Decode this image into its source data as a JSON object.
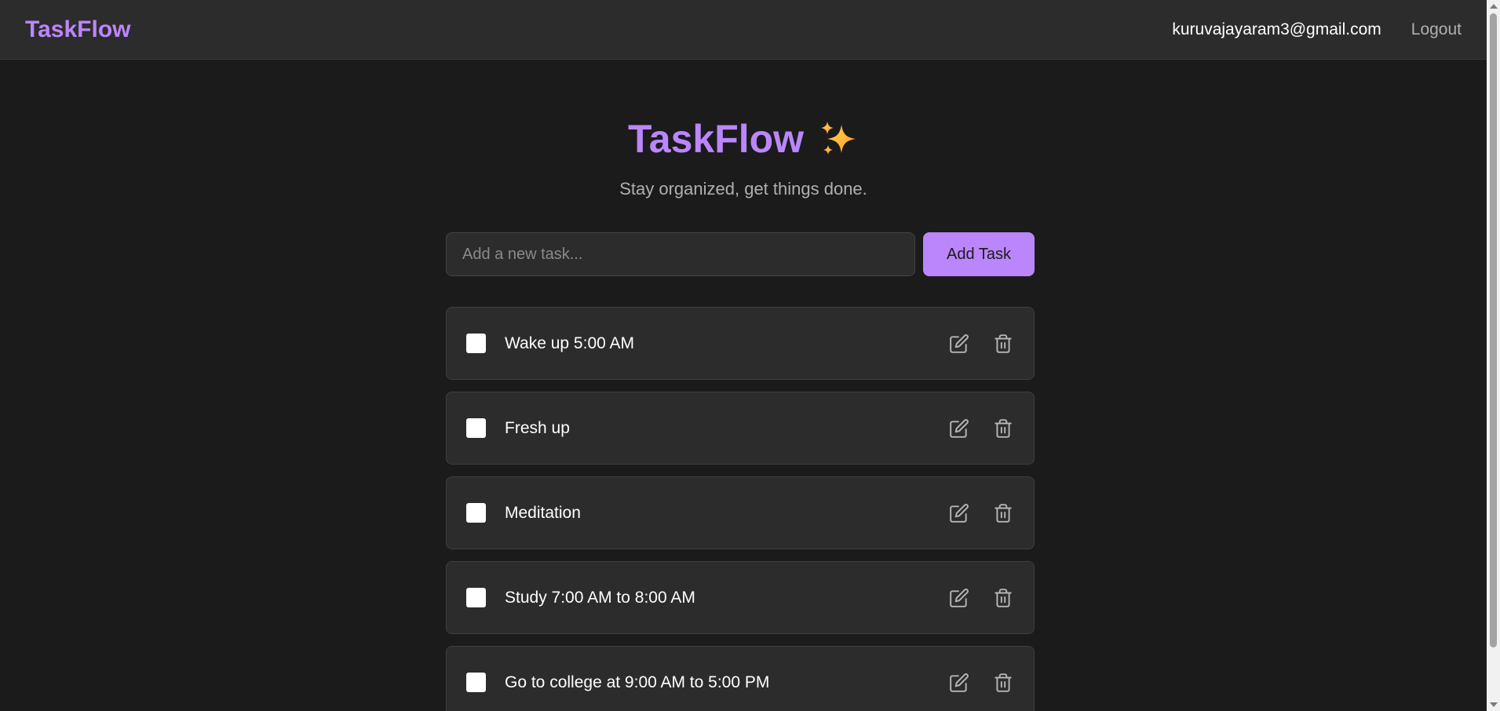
{
  "navbar": {
    "brand": "TaskFlow",
    "user_email": "kuruvajayaram3@gmail.com",
    "logout_label": "Logout"
  },
  "hero": {
    "title": "TaskFlow",
    "sparkle_icon": "sparkles-icon",
    "subtitle": "Stay organized, get things done."
  },
  "add_task": {
    "placeholder": "Add a new task...",
    "value": "",
    "button_label": "Add Task"
  },
  "tasks": [
    {
      "text": "Wake up 5:00 AM",
      "completed": false
    },
    {
      "text": "Fresh up",
      "completed": false
    },
    {
      "text": "Meditation",
      "completed": false
    },
    {
      "text": "Study 7:00 AM to 8:00 AM",
      "completed": false
    },
    {
      "text": "Go to college at 9:00 AM to 5:00 PM",
      "completed": false
    }
  ],
  "icons": {
    "edit": "edit-icon",
    "delete": "trash-icon"
  },
  "colors": {
    "accent": "#bb86fc",
    "background": "#1b1b1b",
    "surface": "#2c2c2c",
    "muted_text": "#b0b0b0"
  }
}
